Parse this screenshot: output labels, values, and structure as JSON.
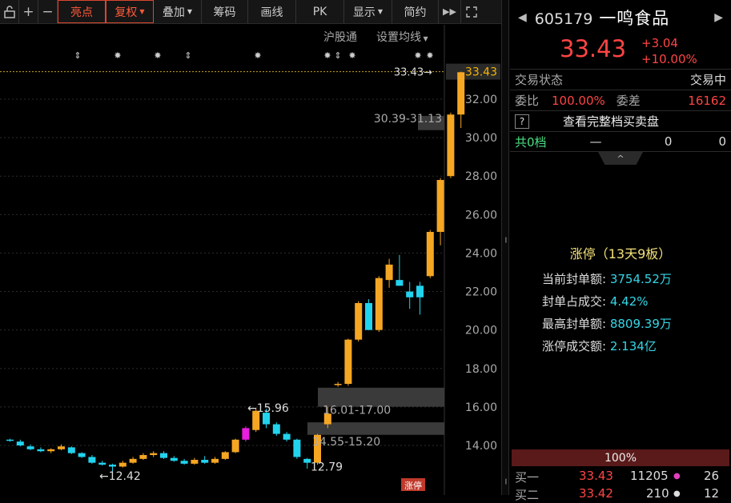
{
  "toolbar": {
    "buttons": [
      "亮点",
      "复权",
      "叠加",
      "筹码",
      "画线",
      "PK",
      "显示",
      "简约"
    ],
    "active": [
      "亮点",
      "复权"
    ]
  },
  "chart_sub": {
    "hugutong": "沪股通",
    "ma_settings": "设置均线"
  },
  "chart_data": {
    "type": "candlestick",
    "y_ticks": [
      "33.43",
      "32.00",
      "30.00",
      "28.00",
      "26.00",
      "24.00",
      "22.00",
      "20.00",
      "18.00",
      "16.00",
      "14.00"
    ],
    "current_price_tag": "33.43",
    "candles": [
      [
        14.3,
        14.35,
        14.2,
        14.25
      ],
      [
        14.2,
        14.3,
        13.95,
        14.0
      ],
      [
        13.95,
        14.05,
        13.75,
        13.8
      ],
      [
        13.8,
        13.9,
        13.65,
        13.7
      ],
      [
        13.7,
        13.85,
        13.6,
        13.8
      ],
      [
        13.8,
        14.05,
        13.75,
        13.95
      ],
      [
        13.9,
        13.95,
        13.55,
        13.6
      ],
      [
        13.6,
        13.65,
        13.35,
        13.4
      ],
      [
        13.4,
        13.5,
        13.05,
        13.1
      ],
      [
        13.1,
        13.2,
        12.95,
        13.0
      ],
      [
        13.0,
        13.05,
        12.42,
        12.9
      ],
      [
        12.9,
        13.2,
        12.85,
        13.1
      ],
      [
        13.1,
        13.4,
        13.05,
        13.3
      ],
      [
        13.3,
        13.6,
        13.25,
        13.5
      ],
      [
        13.5,
        13.7,
        13.4,
        13.6
      ],
      [
        13.6,
        13.7,
        13.3,
        13.35
      ],
      [
        13.35,
        13.45,
        13.15,
        13.2
      ],
      [
        13.2,
        13.3,
        13.0,
        13.05
      ],
      [
        13.05,
        13.35,
        13.0,
        13.25
      ],
      [
        13.25,
        13.45,
        13.05,
        13.1
      ],
      [
        13.1,
        13.4,
        13.05,
        13.3
      ],
      [
        13.3,
        13.7,
        13.25,
        13.65
      ],
      [
        13.65,
        14.35,
        13.6,
        14.3
      ],
      [
        14.3,
        15.0,
        14.2,
        14.9
      ],
      [
        14.8,
        15.96,
        14.7,
        15.8
      ],
      [
        15.7,
        15.9,
        14.9,
        15.1
      ],
      [
        15.1,
        15.2,
        14.5,
        14.6
      ],
      [
        14.6,
        14.7,
        14.2,
        14.3
      ],
      [
        14.3,
        14.35,
        13.3,
        13.4
      ],
      [
        13.3,
        13.35,
        12.79,
        13.1
      ],
      [
        13.1,
        14.6,
        13.0,
        14.55
      ],
      [
        15.1,
        16.01,
        14.9,
        15.65
      ],
      [
        17.2,
        17.3,
        17.05,
        17.2
      ],
      [
        17.2,
        19.55,
        17.1,
        19.5
      ],
      [
        19.5,
        21.5,
        19.4,
        21.4
      ],
      [
        21.4,
        21.6,
        20.0,
        20.0
      ],
      [
        20.0,
        22.8,
        19.9,
        22.7
      ],
      [
        22.6,
        23.7,
        22.2,
        23.4
      ],
      [
        22.6,
        23.9,
        22.3,
        22.3
      ],
      [
        22.0,
        22.5,
        21.1,
        21.7
      ],
      [
        22.3,
        22.5,
        20.8,
        21.7
      ],
      [
        22.8,
        25.2,
        22.7,
        25.1
      ],
      [
        25.1,
        27.9,
        24.4,
        27.8
      ],
      [
        28.0,
        31.3,
        27.9,
        31.2
      ],
      [
        31.2,
        33.43,
        30.5,
        33.4
      ]
    ],
    "high_marker": "←15.96",
    "low_marker": "←12.42",
    "last_high_marker": "33.43→",
    "gap_labels": [
      "30.39-31.13",
      "16.01-17.00",
      "14.55-15.20"
    ],
    "low_label2": "12.79",
    "zhangting_tag": "涨停"
  },
  "quote": {
    "code": "605179",
    "name": "一鸣食品",
    "price": "33.43",
    "change": "+3.04",
    "change_pct": "+10.00%",
    "status_label": "交易状态",
    "status_value": "交易中",
    "weibi_label": "委比",
    "weibi_value": "100.00%",
    "weicha_label": "委差",
    "weicha_value": "16162",
    "help": "?",
    "full_depth": "查看完整档买卖盘",
    "depth_label": "共0档",
    "depth_dash": "—",
    "depth_v1": "0",
    "depth_v2": "0",
    "collapse_icon": "^"
  },
  "zhangting": {
    "title": "涨停（13天9板）",
    "rows": [
      {
        "label": "当前封单额:",
        "value": "3754.52",
        "unit": "万"
      },
      {
        "label": "封单占成交:",
        "value": "4.42%",
        "unit": ""
      },
      {
        "label": "最高封单额:",
        "value": "8809.39",
        "unit": "万"
      },
      {
        "label": "涨停成交额:",
        "value": "2.134",
        "unit": "亿"
      }
    ]
  },
  "book": {
    "ratio": "100%",
    "rows": [
      {
        "label": "买一",
        "price": "33.43",
        "vol": "11205",
        "cnt": "26"
      },
      {
        "label": "买二",
        "price": "33.42",
        "vol": "210",
        "cnt": "12"
      }
    ]
  }
}
